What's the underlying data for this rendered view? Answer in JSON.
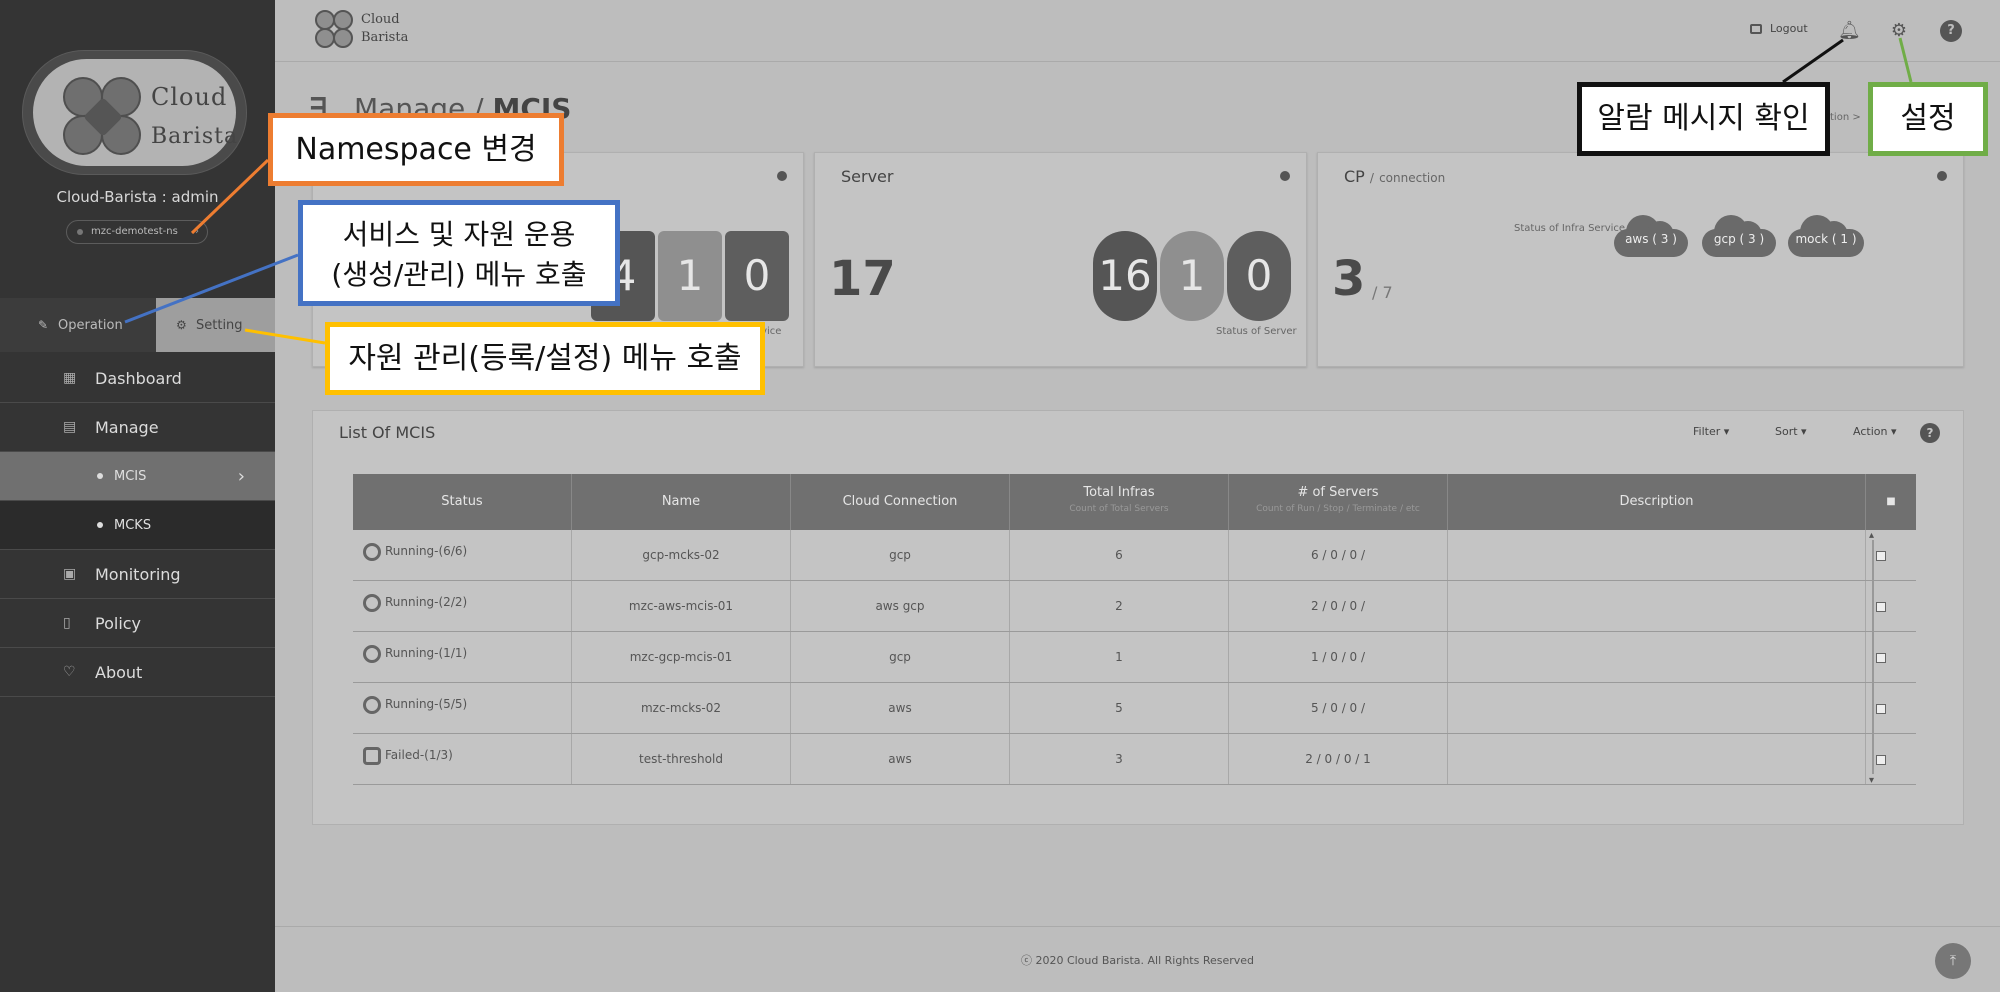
{
  "sidebar": {
    "logo": {
      "line1": "Cloud",
      "line2": "Barista"
    },
    "user": "Cloud-Barista : admin",
    "namespace": "mzc-demotest-ns",
    "tabs": {
      "operation": "Operation",
      "setting": "Setting"
    },
    "menu": {
      "dashboard": "Dashboard",
      "manage": "Manage",
      "mcis": "MCIS",
      "mcks": "MCKS",
      "monitoring": "Monitoring",
      "policy": "Policy",
      "about": "About"
    }
  },
  "header": {
    "logo": {
      "line1": "Cloud",
      "line2": "Barista"
    },
    "logout": "Logout",
    "help": "?"
  },
  "page": {
    "title_prefix": "Manage /",
    "title": "MCIS",
    "breadcrumb": "tion >"
  },
  "cards": {
    "mcis": {
      "pills": [
        "4",
        "1",
        "0"
      ],
      "caption": "rvice"
    },
    "server": {
      "title": "Server",
      "total": "17",
      "pills": [
        "16",
        "1",
        "0"
      ],
      "caption": "Status of Server"
    },
    "cp": {
      "title": "CP",
      "sep": "/",
      "subtitle": "connection",
      "total": "3",
      "of": "/ 7",
      "caption": "Status of Infra Service",
      "clouds": [
        "aws ( 3 )",
        "gcp ( 3 )",
        "mock ( 1 )"
      ]
    }
  },
  "list": {
    "title": "List Of MCIS",
    "filter": "Filter ▾",
    "sort": "Sort ▾",
    "action": "Action ▾",
    "columns": {
      "status": "Status",
      "name": "Name",
      "cloud": "Cloud Connection",
      "infras": "Total Infras",
      "infras_sub": "Count of Total Servers",
      "servers": "# of Servers",
      "servers_sub": "Count of Run / Stop / Terminate / etc",
      "desc": "Description",
      "check": "■"
    },
    "rows": [
      {
        "status": "Running-(6/6)",
        "name": "gcp-mcks-02",
        "cloud": "gcp",
        "infras": "6",
        "servers": "6  /  0  /  0  /",
        "desc": ""
      },
      {
        "status": "Running-(2/2)",
        "name": "mzc-aws-mcis-01",
        "cloud": "aws gcp",
        "infras": "2",
        "servers": "2  /  0  /  0  /",
        "desc": ""
      },
      {
        "status": "Running-(1/1)",
        "name": "mzc-gcp-mcis-01",
        "cloud": "gcp",
        "infras": "1",
        "servers": "1  /  0  /  0  /",
        "desc": ""
      },
      {
        "status": "Running-(5/5)",
        "name": "mzc-mcks-02",
        "cloud": "aws",
        "infras": "5",
        "servers": "5  /  0  /  0  /",
        "desc": ""
      },
      {
        "status": "Failed-(1/3)",
        "name": "test-threshold",
        "cloud": "aws",
        "infras": "3",
        "servers": "2  /  0  /  0  /  1",
        "desc": ""
      }
    ]
  },
  "footer": {
    "copyright": "ⓒ 2020 Cloud Barista. All Rights Reserved",
    "top": "⤒"
  },
  "annotations": {
    "namespace": "Namespace 변경",
    "operation_l1": "서비스 및 자원 운용",
    "operation_l2": "(생성/관리) 메뉴 호출",
    "setting": "자원 관리(등록/설정) 메뉴 호출",
    "alarm": "알람 메시지 확인",
    "settings": "설정"
  },
  "colors": {
    "ann_orange": "#ed7d31",
    "ann_blue": "#4472c4",
    "ann_yellow": "#ffc000",
    "ann_black": "#111111",
    "ann_green": "#70ad47"
  }
}
